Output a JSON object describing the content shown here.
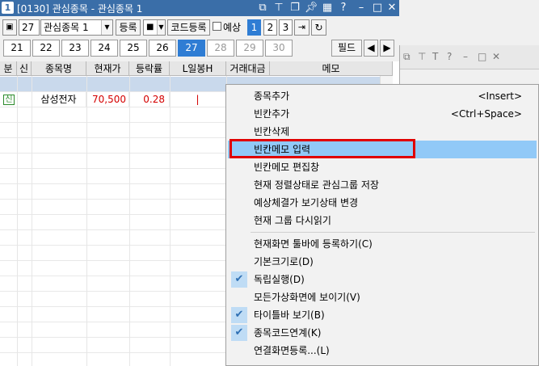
{
  "title": {
    "app_icon": "1",
    "text": "[0130] 관심종목 - 관심종목 1"
  },
  "toolbar": {
    "spinner_value": "27",
    "group_select": "관심종목 1",
    "register_label": "등록",
    "view_select": "■",
    "code_register_label": "코드등록",
    "forecast_label": "예상",
    "page_buttons": [
      "1",
      "2",
      "3"
    ]
  },
  "days": {
    "items": [
      "21",
      "22",
      "23",
      "24",
      "25",
      "26",
      "27",
      "28",
      "29",
      "30"
    ],
    "selected": "27",
    "field_label": "필드"
  },
  "grid": {
    "columns": [
      "분",
      "신",
      "종목명",
      "현재가",
      "등락률",
      "L일봉H",
      "거래대금",
      "메모"
    ],
    "rows": [
      {
        "flag": "신",
        "name": "삼성전자",
        "price": "70,500",
        "change": "0.28",
        "candle": "|"
      }
    ],
    "colors": {
      "up": "#d40000",
      "flag": "#2a8a2a",
      "selected_row": "#c9d9ec"
    }
  },
  "context_menu": {
    "items": [
      {
        "label": "종목추가",
        "shortcut": "<Insert>"
      },
      {
        "label": "빈칸추가",
        "shortcut": "<Ctrl+Space>"
      },
      {
        "label": "빈칸삭제"
      },
      {
        "label": "빈칸메모 입력",
        "highlighted": true
      },
      {
        "label": "빈칸메모 편집창"
      },
      {
        "label": "현재 정렬상태로 관심그룹 저장"
      },
      {
        "label": "예상체결가 보기상태 변경"
      },
      {
        "label": "현재 그룹 다시읽기"
      },
      {
        "label": "현재화면 툴바에 등록하기(C)"
      },
      {
        "label": "기본크기로(D)"
      },
      {
        "label": "독립실행(D)",
        "checked": true
      },
      {
        "label": "모든가상화면에 보이기(V)"
      },
      {
        "label": "타이틀바 보기(B)",
        "checked": true
      },
      {
        "label": "종목코드연계(K)",
        "checked": true
      },
      {
        "label": "연결화면등록...(L)"
      }
    ],
    "highlight_color": "#91c9f7",
    "callout_color": "#e00000"
  }
}
